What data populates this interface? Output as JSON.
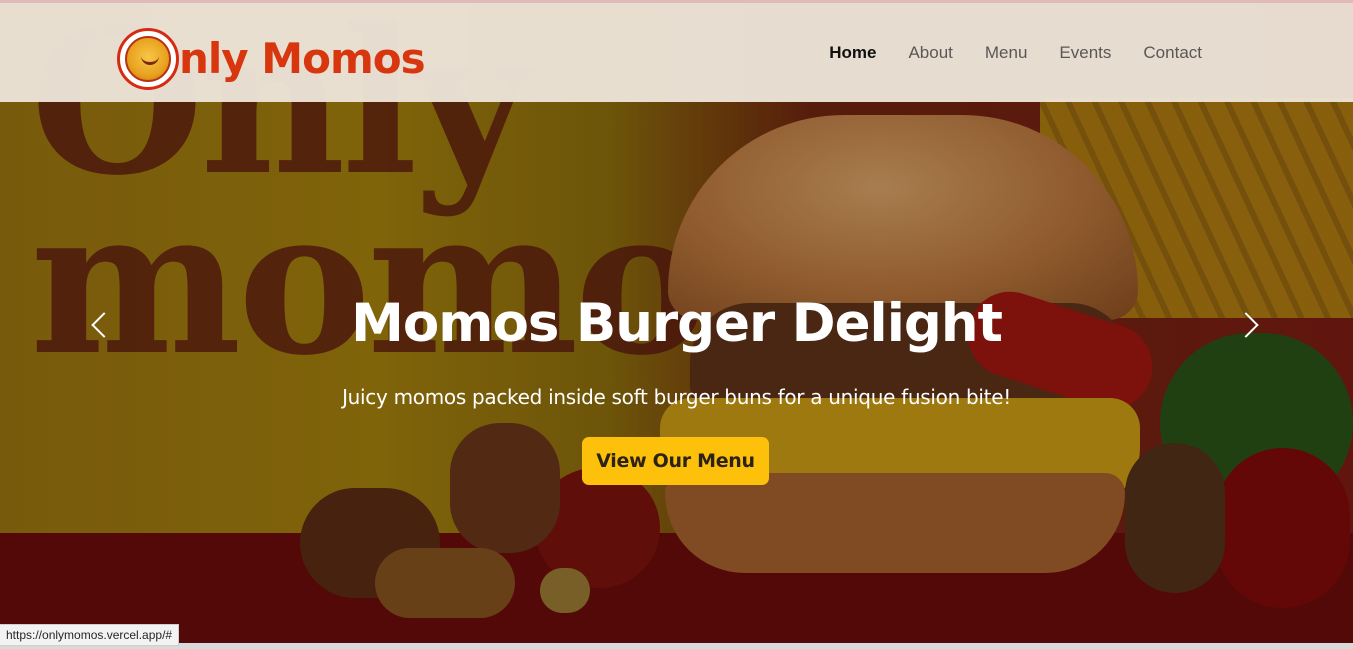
{
  "brand": {
    "name": "nly Momos",
    "logo_icon": "momo-mascot-icon",
    "color": "#d8360f"
  },
  "nav": {
    "items": [
      {
        "label": "Home",
        "active": true
      },
      {
        "label": "About",
        "active": false
      },
      {
        "label": "Menu",
        "active": false
      },
      {
        "label": "Events",
        "active": false
      },
      {
        "label": "Contact",
        "active": false
      }
    ]
  },
  "hero": {
    "title": "Momos Burger Delight",
    "subtitle": "Juicy momos packed inside soft burger buns for a unique fusion bite!",
    "cta_label": "View Our Menu",
    "cta_color": "#fdc00b",
    "prev_icon": "chevron-left-icon",
    "next_icon": "chevron-right-icon"
  },
  "status_bar": {
    "url": "https://onlymomos.vercel.app/#"
  }
}
